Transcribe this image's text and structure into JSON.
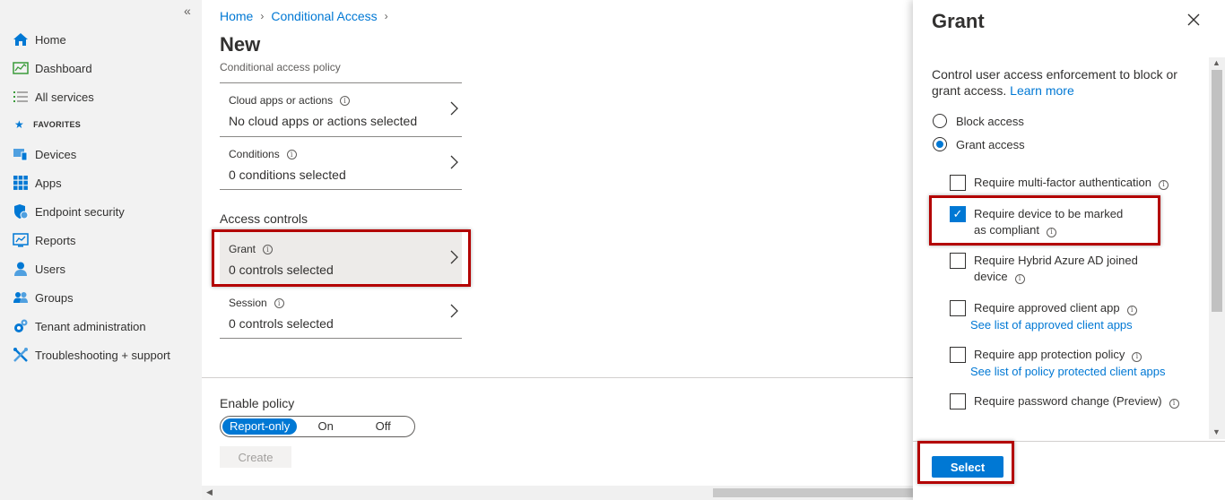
{
  "sidebar": {
    "collapse_glyph": "«",
    "items": [
      {
        "label": "Home",
        "icon": "home-icon"
      },
      {
        "label": "Dashboard",
        "icon": "dashboard-icon"
      },
      {
        "label": "All services",
        "icon": "list-icon"
      }
    ],
    "favorites_label": "FAVORITES",
    "favorites": [
      {
        "label": "Devices",
        "icon": "devices-icon"
      },
      {
        "label": "Apps",
        "icon": "apps-icon"
      },
      {
        "label": "Endpoint security",
        "icon": "shield-icon"
      },
      {
        "label": "Reports",
        "icon": "reports-icon"
      },
      {
        "label": "Users",
        "icon": "user-icon"
      },
      {
        "label": "Groups",
        "icon": "groups-icon"
      },
      {
        "label": "Tenant administration",
        "icon": "gear-icon"
      },
      {
        "label": "Troubleshooting + support",
        "icon": "tools-icon"
      }
    ]
  },
  "breadcrumb": [
    "Home",
    "Conditional Access"
  ],
  "page": {
    "title": "New",
    "subtitle": "Conditional access policy"
  },
  "assignments": [
    {
      "label": "Cloud apps or actions",
      "value": "No cloud apps or actions selected"
    },
    {
      "label": "Conditions",
      "value": "0 conditions selected"
    }
  ],
  "access_controls": {
    "heading": "Access controls",
    "items": [
      {
        "label": "Grant",
        "value": "0 controls selected"
      },
      {
        "label": "Session",
        "value": "0 controls selected"
      }
    ]
  },
  "enable_policy": {
    "label": "Enable policy",
    "options": [
      "Report-only",
      "On",
      "Off"
    ],
    "selected": "Report-only",
    "create_label": "Create"
  },
  "grant_panel": {
    "title": "Grant",
    "description": "Control user access enforcement to block or grant access.",
    "learn_more": "Learn more",
    "radios": [
      {
        "label": "Block access",
        "checked": false
      },
      {
        "label": "Grant access",
        "checked": true
      }
    ],
    "checkboxes": [
      {
        "label": "Require multi-factor authentication",
        "checked": false,
        "link": ""
      },
      {
        "label": "Require device to be marked as compliant",
        "checked": true,
        "link": ""
      },
      {
        "label": "Require Hybrid Azure AD joined device",
        "checked": false,
        "link": ""
      },
      {
        "label": "Require approved client app",
        "checked": false,
        "link": "See list of approved client apps"
      },
      {
        "label": "Require app protection policy",
        "checked": false,
        "link": "See list of policy protected client apps"
      },
      {
        "label": "Require password change (Preview)",
        "checked": false,
        "link": ""
      }
    ],
    "select_label": "Select"
  },
  "colors": {
    "accent": "#0078d4",
    "highlight": "#b30000"
  }
}
